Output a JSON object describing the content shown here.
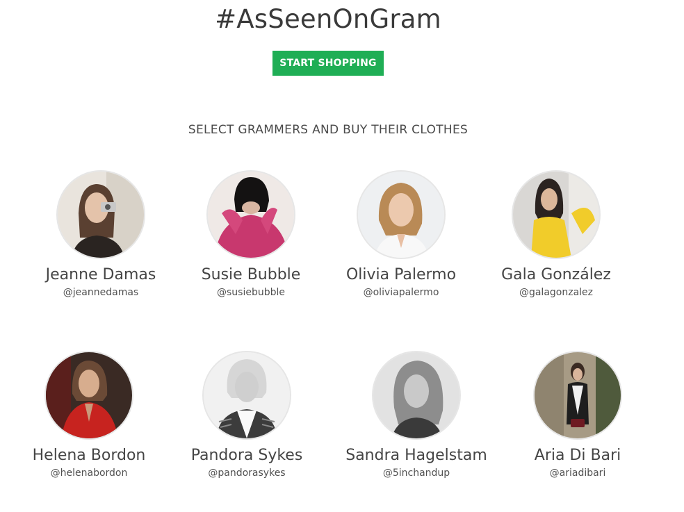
{
  "header": {
    "title": "#AsSeenOnGram",
    "cta_label": "START SHOPPING",
    "subtitle": "SELECT GRAMMERS AND BUY THEIR CLOTHES"
  },
  "colors": {
    "accent": "#1fae55",
    "text": "#404040",
    "avatar_border": "#e6e6e6"
  },
  "grammers": [
    {
      "name": "Jeanne Damas",
      "handle": "@jeannedamas"
    },
    {
      "name": "Susie Bubble",
      "handle": "@susiebubble"
    },
    {
      "name": "Olivia Palermo",
      "handle": "@oliviapalermo"
    },
    {
      "name": "Gala González",
      "handle": "@galagonzalez"
    },
    {
      "name": "Helena Bordon",
      "handle": "@helenabordon"
    },
    {
      "name": "Pandora Sykes",
      "handle": "@pandorasykes"
    },
    {
      "name": "Sandra Hagelstam",
      "handle": "@5inchandup"
    },
    {
      "name": "Aria Di Bari",
      "handle": "@ariadibari"
    }
  ]
}
